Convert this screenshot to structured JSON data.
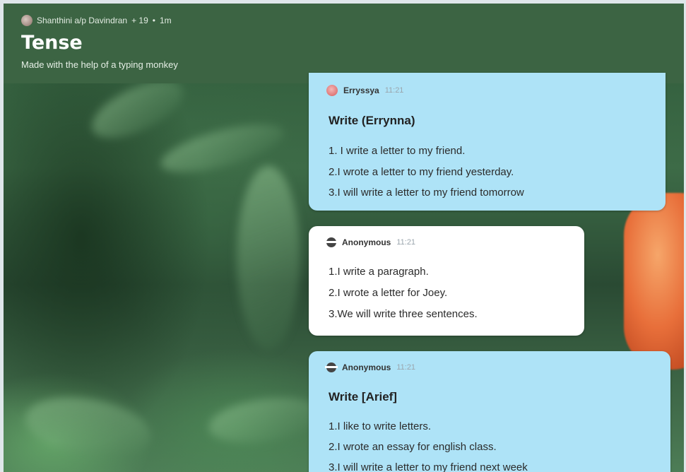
{
  "header": {
    "author": "Shanthini a/p Davindran",
    "likes": "+ 19",
    "separator": "•",
    "age": "1m",
    "title": "Tense",
    "subtitle": "Made with the help of a typing monkey"
  },
  "posts": [
    {
      "author": "Erryssya",
      "time": "11:21",
      "title": "Write (Errynna)",
      "lines": [
        "1. I write a letter to my friend.",
        "2.I wrote a letter to my friend yesterday.",
        "3.I will write a letter to my friend tomorrow"
      ]
    },
    {
      "author": "Anonymous",
      "time": "11:21",
      "title": "",
      "lines": [
        "1.I write a paragraph.",
        "2.I wrote a letter for Joey.",
        "3.We will write three sentences."
      ]
    },
    {
      "author": "Anonymous",
      "time": "11:21",
      "title": "Write [Arief]",
      "lines": [
        "1.I like to write letters.",
        "2.I wrote an essay for english class.",
        "3.I will write a letter to my friend next week"
      ]
    }
  ],
  "colors": {
    "header_bg": "#3c6443",
    "card_blue": "#aee3f7",
    "card_white": "#ffffff"
  }
}
